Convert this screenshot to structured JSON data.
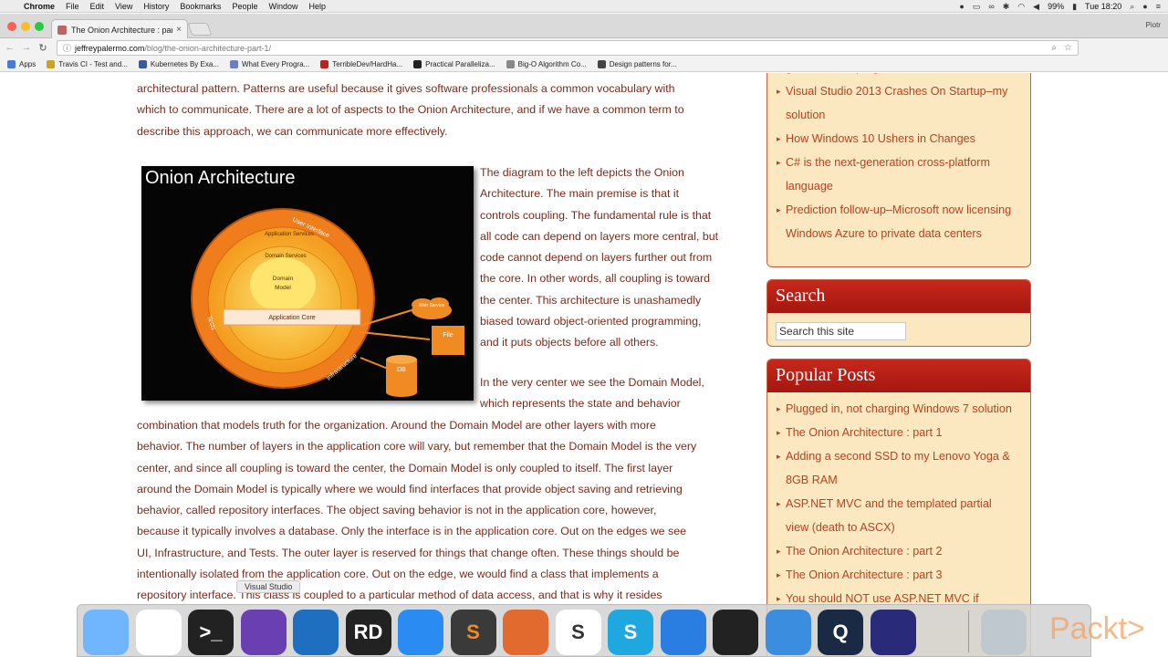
{
  "menubar": {
    "items": [
      "Chrome",
      "File",
      "Edit",
      "View",
      "History",
      "Bookmarks",
      "People",
      "Window",
      "Help"
    ],
    "battery": "99%",
    "clock": "Tue 18:20"
  },
  "tab": {
    "title": "The Onion Architecture : part",
    "close": "×"
  },
  "profile": "Piotr",
  "address": {
    "host": "jeffreypalermo.com",
    "path": "/blog/the-onion-architecture-part-1/"
  },
  "bookmarks": [
    "Apps",
    "Travis CI - Test and...",
    "Kubernetes By Exa...",
    "What Every Progra...",
    "TerribleDev/HardHa...",
    "Practical Paralleliza...",
    "Big-O Algorithm Co...",
    "Design patterns for..."
  ],
  "article": {
    "intro_lines": [
      "architectural pattern.  Patterns are useful because it gives software professionals a common vocabulary with",
      "which to communicate.  There are a lot of aspects to the Onion Architecture, and if we have a common term to",
      "describe this approach, we can communicate more effectively."
    ],
    "side_lines": [
      "The diagram to the left depicts the Onion",
      "Architecture.  The main premise is that it",
      "controls coupling.  The fundamental rule is that",
      "all code can depend on layers more central, but",
      "code cannot depend on layers further out from",
      "the core.  In other words, all coupling is toward",
      "the center.   This architecture is unashamedly",
      "biased toward object-oriented programming,",
      "and it puts objects before all others."
    ],
    "center_lines": [
      "In the very center we see the Domain Model,",
      "which represents the state and behavior"
    ],
    "body_lines": [
      "combination that models truth for the organization.  Around the Domain Model are other layers with more",
      "behavior.  The number of layers in the application core will vary, but remember that the Domain Model is the very",
      "center, and since all coupling is toward the center, the Domain Model is only coupled to itself.  The first layer",
      "around the Domain Model is typically where we would find interfaces that provide object saving and retrieving",
      "behavior, called repository interfaces.  The object saving behavior is not in the application core, however,",
      "because it typically involves a database.  Only the interface is in the application core.  Out on the edges we see",
      "UI, Infrastructure, and Tests.  The outer layer is reserved for things that change often.  These things should be",
      "intentionally isolated from the application core.  Out on the edge, we would find a class that implements a",
      "repository interface.  This class is coupled to a particular method of data access, and that is why it resides"
    ]
  },
  "diagram": {
    "title": "Onion Architecture",
    "labels": {
      "ui": "User Interface",
      "app_services": "Application Services",
      "domain_services": "Domain Services",
      "domain_model": "Domain",
      "domain_model2": "Model",
      "core": "Application Core",
      "tests": "Tests",
      "infra": "Infrastructure",
      "web": "Web Service",
      "file": "File",
      "db": "DB"
    }
  },
  "sidebar": {
    "recent_posts": [
      "generation of programmers in Austin, TX",
      "Visual Studio 2013 Crashes On Startup–my|solution",
      "How Windows 10 Ushers in Changes",
      "C# is the next-generation cross-platform|language",
      "Prediction follow-up–Microsoft now licensing|Windows Azure to private data centers"
    ],
    "search_title": "Search",
    "search_placeholder": "Search this site",
    "popular_title": "Popular Posts",
    "popular_posts": [
      "Plugged in, not charging Windows 7 solution",
      "The Onion Architecture : part 1",
      "Adding a second SSD to my Lenovo Yoga &|8GB RAM",
      "ASP.NET MVC and the templated partial|view (death to ASCX)",
      "The Onion Architecture : part 2",
      "The Onion Architecture : part 3",
      "You should NOT use ASP.NET MVC if"
    ]
  },
  "tooltip": "Visual Studio",
  "dock": {
    "apps": [
      "finder-icon",
      "chrome-icon",
      "terminal-icon",
      "visual-studio-icon",
      "vscode-icon",
      "rider-icon",
      "messenger-icon",
      "sublime-icon",
      "postman-icon",
      "slack-icon",
      "skype-icon",
      "navigation-icon",
      "spotify-icon",
      "keynote-icon",
      "quicktime-icon",
      "audacity-icon"
    ],
    "labels": [
      "",
      "",
      ">_",
      "",
      "",
      "RD",
      "",
      "S",
      "",
      "S",
      "S",
      "",
      "",
      "",
      "Q",
      ""
    ]
  },
  "watermark": "Packt>"
}
